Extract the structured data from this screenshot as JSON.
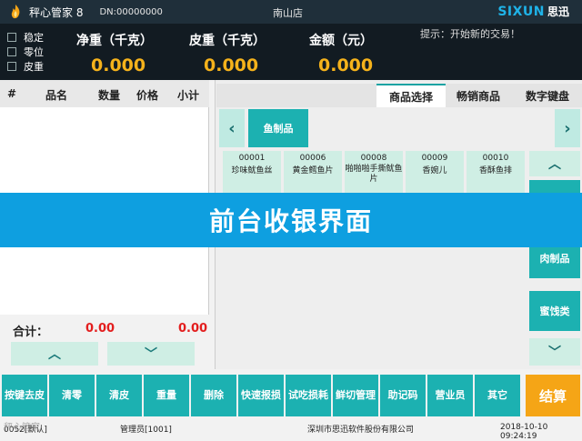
{
  "titlebar": {
    "app_title": "秤心管家 8",
    "dn": "DN:00000000",
    "store": "南山店",
    "brand_en": "SIXUN",
    "brand_zh": "思迅"
  },
  "scale": {
    "flags": [
      "稳定",
      "零位",
      "皮重"
    ],
    "net_label": "净重（千克）",
    "net_value": "0.000",
    "tare_label": "皮重（千克）",
    "tare_value": "0.000",
    "amount_label": "金额（元）",
    "amount_value": "0.000",
    "hint": "提示：开始新的交易！"
  },
  "order": {
    "columns": [
      "#",
      "品名",
      "数量",
      "价格",
      "小计"
    ],
    "total_label": "合计：",
    "total_qty": "0.00",
    "total_sum": "0.00"
  },
  "goods": {
    "tabs": [
      "商品选择",
      "畅销商品",
      "数字键盘"
    ],
    "active_category": "鱼制品",
    "products": [
      {
        "code": "00001",
        "name": "珍味鱿鱼丝"
      },
      {
        "code": "00006",
        "name": "黄金鳕鱼片"
      },
      {
        "code": "00008",
        "name": "啪啪啪手撕鱿鱼片"
      },
      {
        "code": "00009",
        "name": "香婉儿"
      },
      {
        "code": "00010",
        "name": "香酥鱼排"
      }
    ],
    "side_categories": [
      "肉制品",
      "蜜饯类"
    ]
  },
  "banner": {
    "text": "前台收银界面"
  },
  "functions": [
    "按键去皮",
    "清零",
    "清皮",
    "重量",
    "删除",
    "快速报损",
    "试吃损耗",
    "鲜切管理",
    "助记码",
    "营业员",
    "其它"
  ],
  "checkout_label": "结算",
  "status": {
    "left": "0052[默认]",
    "operator": "管理员[1001]",
    "company": "深圳市思迅软件股份有限公司",
    "datetime": "2018-10-10 09:24:19",
    "watermark": "秤心管家"
  },
  "colors": {
    "teal": "#1cb1b1",
    "light_teal": "#cfeee4",
    "amber": "#f5b21b",
    "banner_blue": "#0e9fe0",
    "checkout_orange": "#f5a516",
    "total_red": "#e31e1e"
  }
}
